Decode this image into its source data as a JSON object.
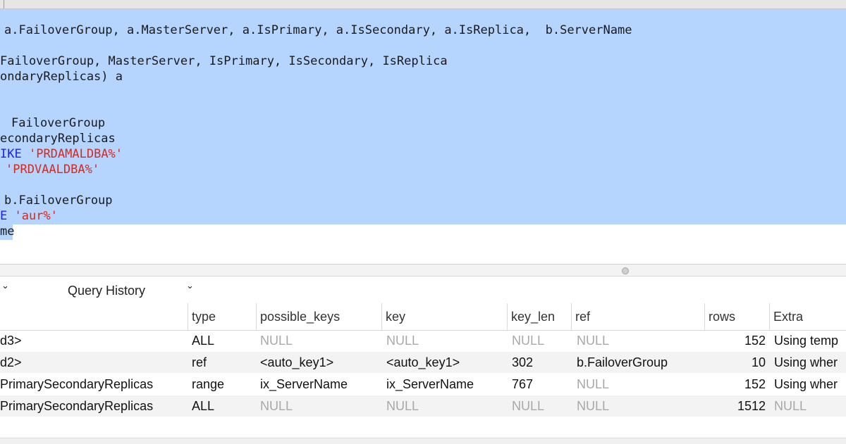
{
  "editor": {
    "line1": "a.FailoverGroup, a.MasterServer, a.IsPrimary, a.IsSecondary, a.IsReplica,  b.ServerName",
    "line3": "FailoverGroup, MasterServer, IsPrimary, IsSecondary, IsReplica",
    "line4": "ondaryReplicas) a",
    "line7": "FailoverGroup",
    "line8": "econdaryReplicas",
    "line9_kw": "IKE",
    "line9_str": "'PRDAMALDBA%'",
    "line10_str": "'PRDVAALDBA%'",
    "line12": "b.FailoverGroup",
    "line13_kw": "E",
    "line13_str": "'aur%'",
    "line14": "me"
  },
  "tabs": {
    "history_label": "Query History",
    "dropdown_icon": "chevron-down-icon"
  },
  "results": {
    "columns": [
      "type",
      "possible_keys",
      "key",
      "key_len",
      "ref",
      "rows",
      "Extra"
    ],
    "rows": [
      {
        "table": "d3>",
        "type": "ALL",
        "possible_keys": "NULL",
        "key": "NULL",
        "key_len": "NULL",
        "ref": "NULL",
        "rows": "152",
        "extra": "Using temp"
      },
      {
        "table": "d2>",
        "type": "ref",
        "possible_keys": "<auto_key1>",
        "key": "<auto_key1>",
        "key_len": "302",
        "ref": "b.FailoverGroup",
        "rows": "10",
        "extra": "Using wher"
      },
      {
        "table": "PrimarySecondaryReplicas",
        "type": "range",
        "possible_keys": "ix_ServerName",
        "key": "ix_ServerName",
        "key_len": "767",
        "ref": "NULL",
        "rows": "152",
        "extra": "Using wher"
      },
      {
        "table": "PrimarySecondaryReplicas",
        "type": "ALL",
        "possible_keys": "NULL",
        "key": "NULL",
        "key_len": "NULL",
        "ref": "NULL",
        "rows": "1512",
        "extra": "NULL"
      }
    ]
  },
  "colors": {
    "selection": "#b5d5ff",
    "keyword": "#1d1ff0",
    "string": "#d42a20",
    "null_text": "#a8a8a8",
    "alt_row": "#f3f3f3"
  }
}
